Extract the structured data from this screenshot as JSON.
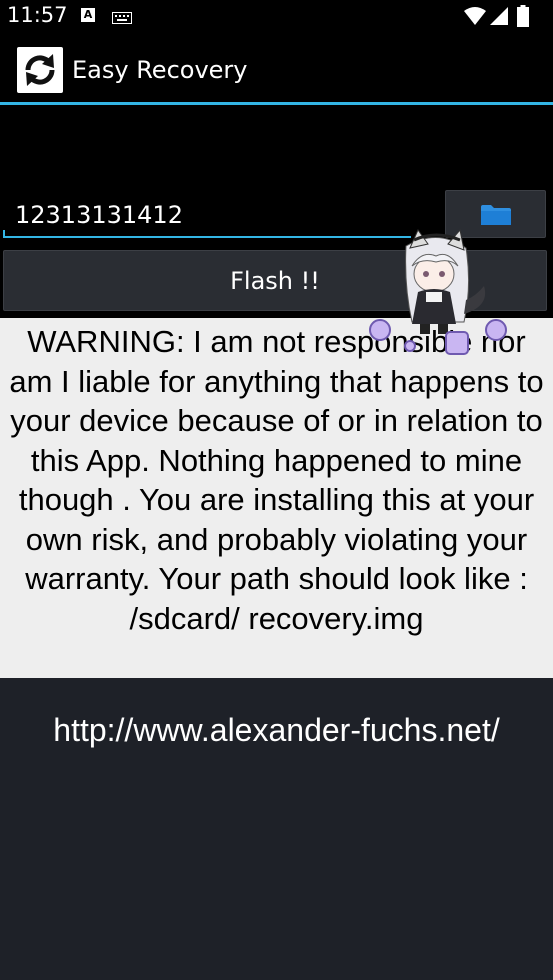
{
  "status_bar": {
    "time": "11:57",
    "notification_icons": [
      "a-icon",
      "keyboard-icon"
    ],
    "system_icons": [
      "wifi-icon",
      "signal-icon",
      "battery-icon"
    ]
  },
  "action_bar": {
    "app_icon": "refresh-icon",
    "title": "Easy Recovery"
  },
  "form": {
    "path_value": "12313131412",
    "browse_icon": "folder-icon",
    "flash_label": "Flash !!"
  },
  "warning": {
    "text": "WARNING: I am not responsible nor am I liable for anything that happens to your device because of or in relation to this App. Nothing happened to mine though . You are installing this at your own risk, and probably violating your warranty. Your path should look like : /sdcard/ recovery.img"
  },
  "footer": {
    "url": "http://www.alexander-fuchs.net/"
  },
  "colors": {
    "accent": "#33b5e5",
    "background": "#1e2128",
    "warning_bg": "#eeeeee",
    "folder": "#2f8fe0"
  }
}
